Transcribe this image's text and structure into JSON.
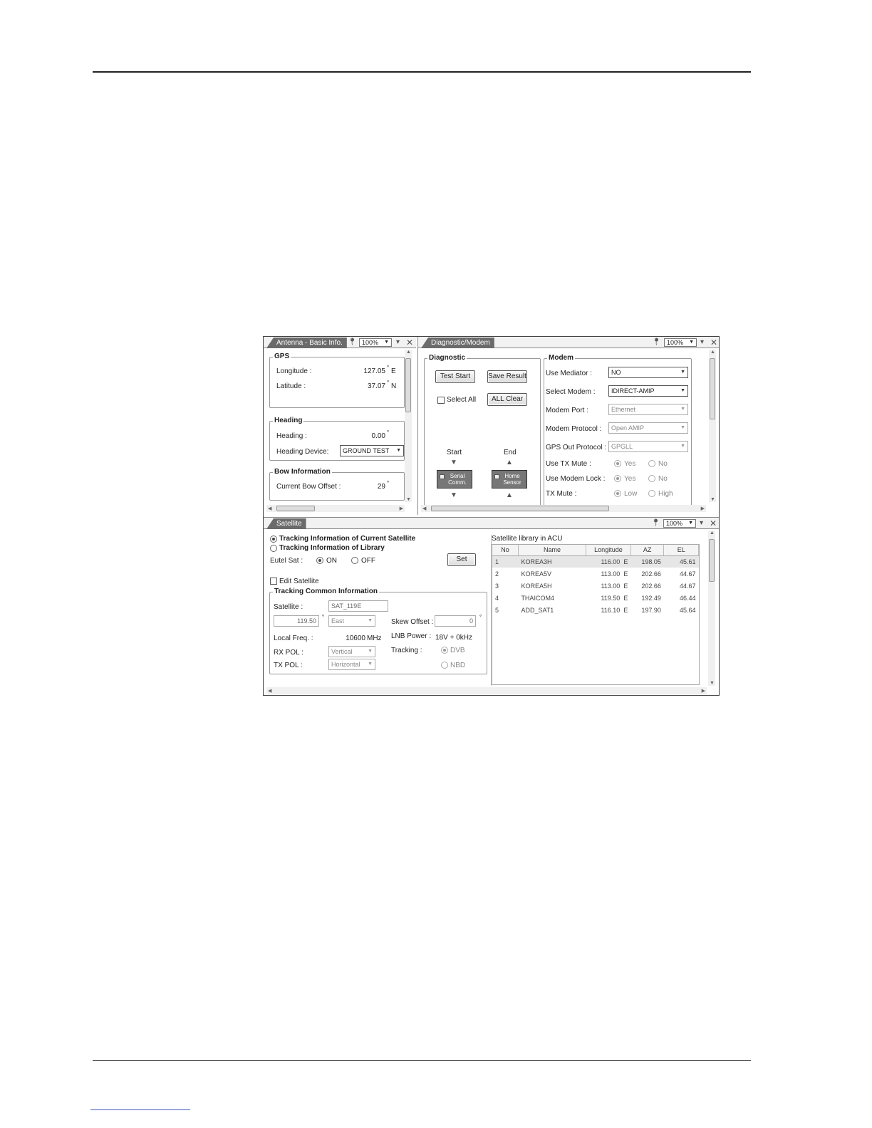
{
  "antenna_pane": {
    "tab_label": "Antenna - Basic Info.",
    "zoom": "100%",
    "gps": {
      "title": "GPS",
      "longitude_label": "Longitude :",
      "longitude_value": "127.05",
      "longitude_dir": "E",
      "latitude_label": "Latitude :",
      "latitude_value": "37.07",
      "latitude_dir": "N"
    },
    "heading": {
      "title": "Heading",
      "heading_label": "Heading :",
      "heading_value": "0.00",
      "device_label": "Heading Device:",
      "device_value": "GROUND TEST"
    },
    "bow": {
      "title": "Bow Information",
      "offset_label": "Current Bow Offset :",
      "offset_value": "29"
    },
    "degree": "°"
  },
  "diagnostic_pane": {
    "tab_label": "Diagnostic/Modem",
    "zoom": "100%",
    "diagnostic": {
      "title": "Diagnostic",
      "test_start": "Test Start",
      "save_result": "Save Result",
      "select_all": "Select All",
      "all_clear": "ALL Clear",
      "start_label": "Start",
      "end_label": "End",
      "serial_comm": "Serial Comm.",
      "home_sensor": "Home Sensor"
    },
    "modem": {
      "title": "Modem",
      "use_mediator_label": "Use Mediator :",
      "use_mediator_value": "NO",
      "select_modem_label": "Select Modem :",
      "select_modem_value": "IDIRECT-AMIP",
      "modem_port_label": "Modem Port :",
      "modem_port_value": "Ethernet",
      "modem_protocol_label": "Modem Protocol :",
      "modem_protocol_value": "Open AMIP",
      "gps_out_label": "GPS Out Protocol :",
      "gps_out_value": "GPGLL",
      "use_tx_mute_label": "Use TX Mute :",
      "use_modem_lock_label": "Use Modem Lock :",
      "tx_mute_label": "TX Mute :",
      "yes": "Yes",
      "no": "No",
      "low": "Low",
      "high": "High"
    }
  },
  "satellite_pane": {
    "tab_label": "Satellite",
    "zoom": "100%",
    "radio_current": "Tracking Information of Current Satellite",
    "radio_library": "Tracking Information of Library",
    "eutel_label": "Eutel Sat :",
    "on_label": "ON",
    "off_label": "OFF",
    "set_button": "Set",
    "edit_satellite": "Edit Satellite",
    "tracking_common": {
      "title": "Tracking Common  Information",
      "satellite_label": "Satellite :",
      "satellite_value": "SAT_119E",
      "longitude_value": "119.50",
      "direction_value": "East",
      "skew_label": "Skew Offset :",
      "skew_value": "0",
      "local_freq_label": "Local Freq. :",
      "local_freq_value": "10600",
      "mhz": "MHz",
      "lnb_label": "LNB Power :",
      "lnb_value": "18V + 0kHz",
      "rx_pol_label": "RX POL :",
      "rx_pol_value": "Vertical",
      "tx_pol_label": "TX POL :",
      "tx_pol_value": "Horizontal",
      "tracking_label": "Tracking :",
      "dvb": "DVB",
      "nbd": "NBD"
    },
    "library": {
      "title": "Satellite library in ACU",
      "headers": [
        "No",
        "Name",
        "Longitude",
        "AZ",
        "EL"
      ],
      "rows": [
        {
          "no": "1",
          "name": "KOREA3H",
          "lon": "116.00",
          "dir": "E",
          "az": "198.05",
          "el": "45.61"
        },
        {
          "no": "2",
          "name": "KOREA5V",
          "lon": "113.00",
          "dir": "E",
          "az": "202.66",
          "el": "44.67"
        },
        {
          "no": "3",
          "name": "KOREA5H",
          "lon": "113.00",
          "dir": "E",
          "az": "202.66",
          "el": "44.67"
        },
        {
          "no": "4",
          "name": "THAICOM4",
          "lon": "119.50",
          "dir": "E",
          "az": "192.49",
          "el": "46.44"
        },
        {
          "no": "5",
          "name": "ADD_SAT1",
          "lon": "116.10",
          "dir": "E",
          "az": "197.90",
          "el": "45.64"
        }
      ]
    }
  }
}
